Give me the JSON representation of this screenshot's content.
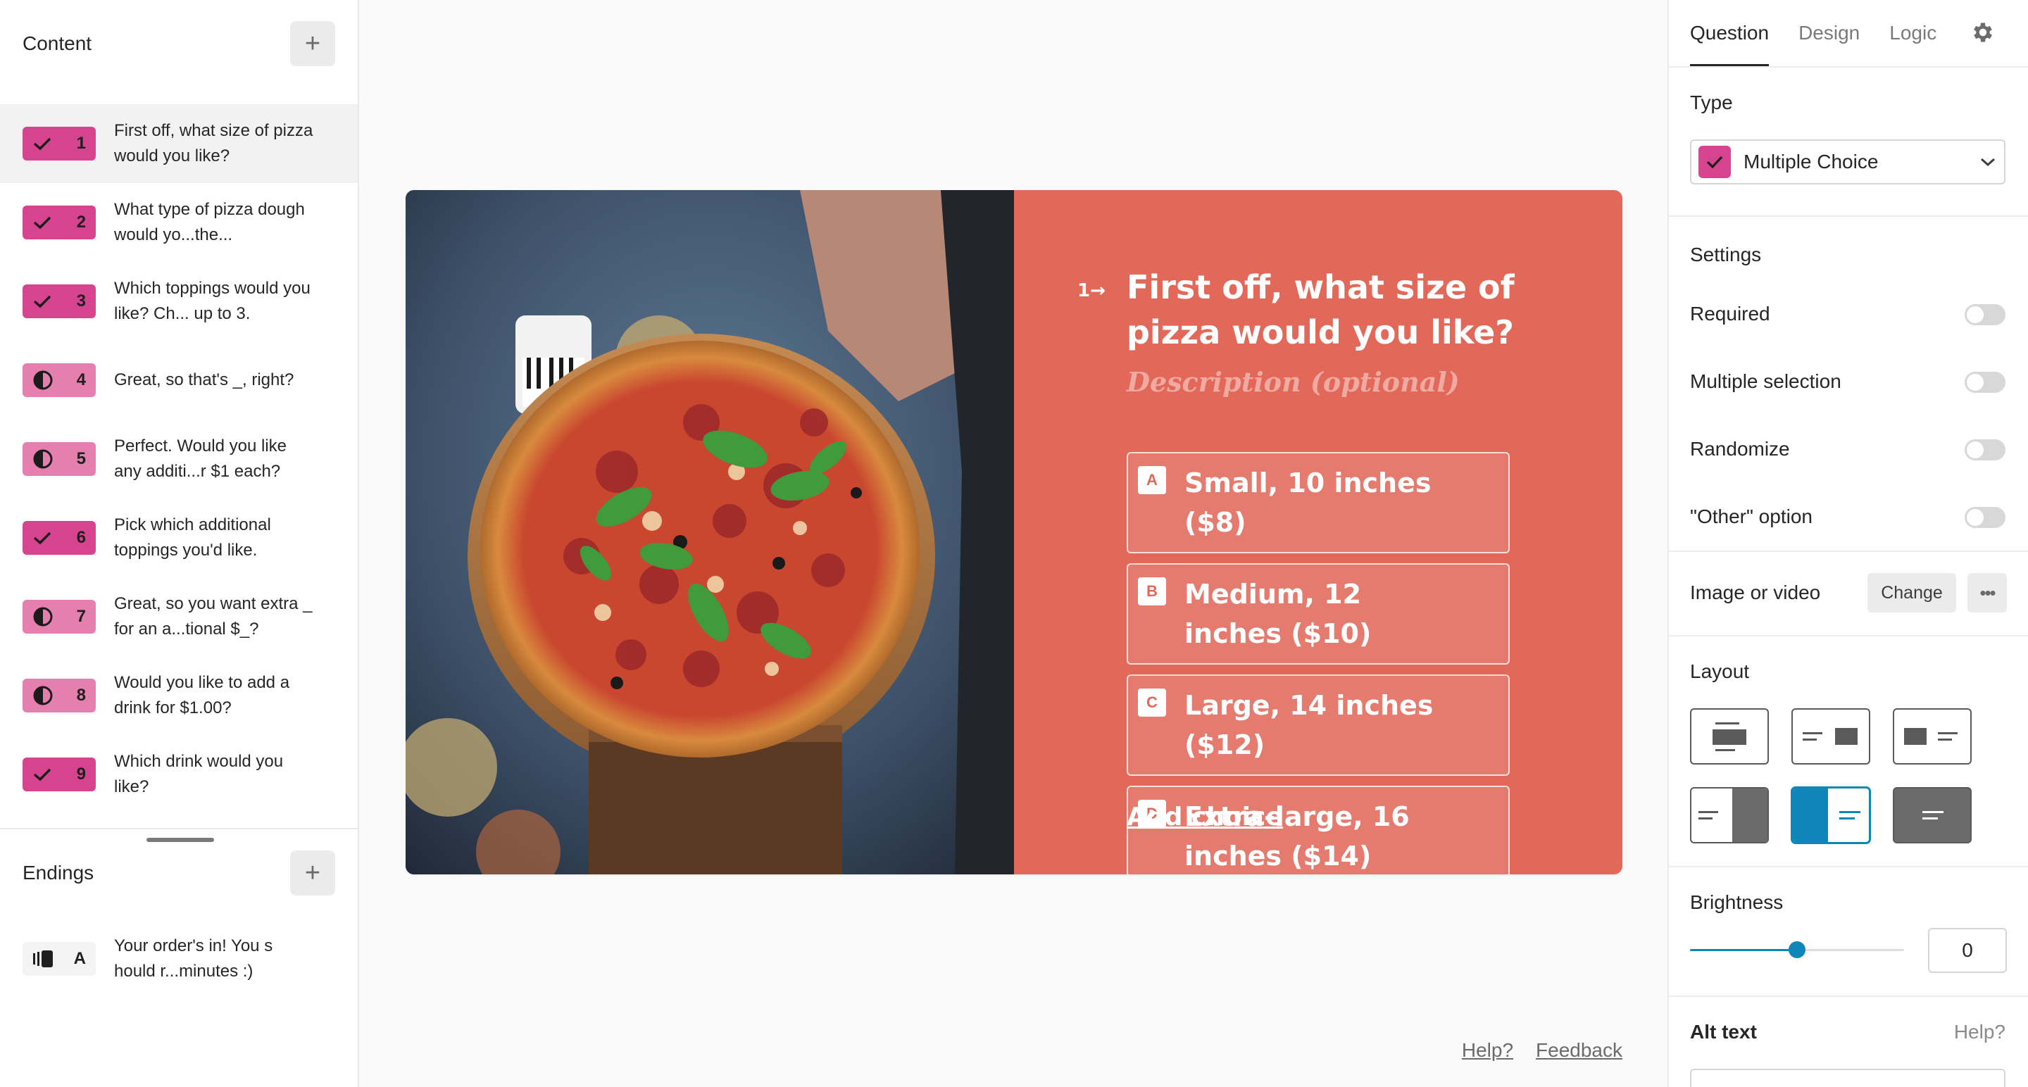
{
  "content": {
    "title": "Content",
    "add_label": "+",
    "questions": [
      {
        "number": "1",
        "text": "First off, what size of pizza would you like?",
        "type": "multiple-choice",
        "active": true
      },
      {
        "number": "2",
        "text": "What type of pizza dough would yo...the...",
        "type": "multiple-choice"
      },
      {
        "number": "3",
        "text": "Which toppings would you like? Ch... up to 3.",
        "type": "multiple-choice"
      },
      {
        "number": "4",
        "text": "Great, so that's _, right?",
        "type": "statement"
      },
      {
        "number": "5",
        "text": "Perfect. Would you like any additi...r $1 each?",
        "type": "statement"
      },
      {
        "number": "6",
        "text": "Pick which additional toppings you'd like.",
        "type": "multiple-choice"
      },
      {
        "number": "7",
        "text": "Great, so you want extra _ for an a...tional $_?",
        "type": "statement"
      },
      {
        "number": "8",
        "text": "Would you like to add a drink for $1.00?",
        "type": "statement"
      },
      {
        "number": "9",
        "text": "Which drink would you like?",
        "type": "multiple-choice"
      }
    ]
  },
  "endings": {
    "title": "Endings",
    "add_label": "+",
    "items": [
      {
        "key": "A",
        "text": "Your order's in! You s hould r...minutes :)"
      }
    ]
  },
  "question_card": {
    "number": "1",
    "title": "First off, what size of pizza would you like?",
    "description": "Description (optional)",
    "choices": [
      {
        "key": "A",
        "label": "Small, 10 inches ($8)"
      },
      {
        "key": "B",
        "label": "Medium, 12 inches ($10)"
      },
      {
        "key": "C",
        "label": "Large, 14 inches ($12)"
      },
      {
        "key": "D",
        "label": "Extra-large, 16 inches ($14)"
      }
    ],
    "add_choice": "Add choice",
    "background_color": "#e2695a"
  },
  "footer": {
    "help": "Help?",
    "feedback": "Feedback"
  },
  "panel": {
    "tabs": [
      "Question",
      "Design",
      "Logic"
    ],
    "active_tab": "Question",
    "type_label": "Type",
    "type_value": "Multiple Choice",
    "settings_label": "Settings",
    "settings": [
      {
        "label": "Required",
        "on": false
      },
      {
        "label": "Multiple selection",
        "on": false
      },
      {
        "label": "Randomize",
        "on": false
      },
      {
        "label": "\"Other\" option",
        "on": false
      }
    ],
    "image_label": "Image or video",
    "change_label": "Change",
    "more_label": "•••",
    "layout_label": "Layout",
    "brightness_label": "Brightness",
    "brightness_value": "0",
    "brightness_fraction": 0.5,
    "alt_text_label": "Alt text",
    "alt_help": "Help?",
    "accent_color": "#0e87b8"
  }
}
